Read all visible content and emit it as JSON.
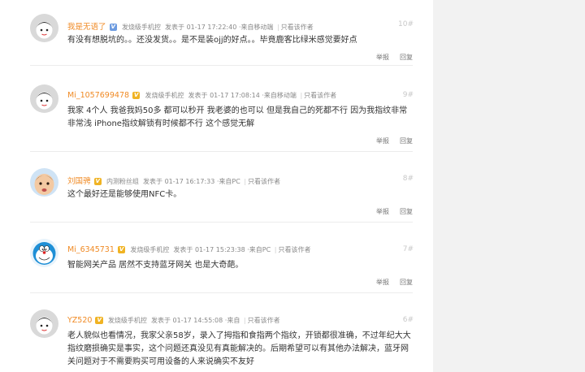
{
  "labels": {
    "post_time_prefix": "发表于",
    "only_author": "只看该作者",
    "report": "举报",
    "reply": "回复"
  },
  "posts": [
    {
      "username": "我是无语了",
      "badge": "V",
      "level": "发烧级手机控",
      "time": "01-17 17:22:40",
      "source": "来自移动端",
      "floor": "10#",
      "content": "有没有想脱坑的。。还没发货。。是不是装ojj的好点。。毕竟鹿客比绿米感觉要好点"
    },
    {
      "username": "Mi_1057699478",
      "badge": "V",
      "level": "发烧级手机控",
      "time": "01-17 17:08:14",
      "source": "来自移动端",
      "floor": "9#",
      "content": "我家 4个人 我爸我妈50多 都可以秒开 我老婆的也可以 但是我自己的死都不行 因为我指纹非常非常浅 iPhone指纹解锁有时候都不行 这个感觉无解"
    },
    {
      "username": "刘国骋",
      "badge": "V",
      "level": "内测粉丝组",
      "time": "01-17 16:17:33",
      "source": "来自PC",
      "floor": "8#",
      "content": "这个最好还是能够使用NFC卡。"
    },
    {
      "username": "Mi_6345731",
      "badge": "V",
      "level": "发烧级手机控",
      "time": "01-17 15:23:38",
      "source": "来自PC",
      "floor": "7#",
      "content": "智能网关产品 居然不支持蓝牙网关 也是大奇葩。"
    },
    {
      "username": "YZ520",
      "badge": "V",
      "level": "发烧级手机控",
      "time": "01-17 14:55:08",
      "source": "来自",
      "floor": "6#",
      "content": "老人貌似也看情况，我家父亲58岁，录入了拇指和食指两个指纹，开锁都很准确，不过年纪大大指纹磨损确实是事实，这个问题还真没见有真能解决的。后期希望可以有其他办法解决，蓝牙网关问题对于不需要购买可用设备的人来说确实不友好"
    }
  ],
  "colors": {
    "username": "#f08a24",
    "badge_blue": "#6c9be0",
    "badge_gold": "#f0b323",
    "floor": "#c8c8c8"
  }
}
